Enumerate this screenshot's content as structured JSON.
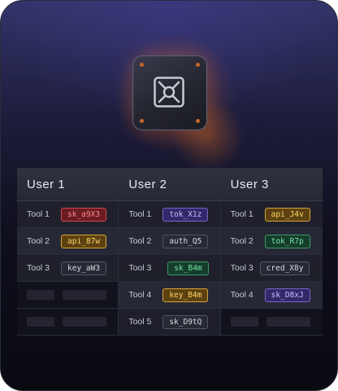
{
  "colors": {
    "red": "#d44a4a",
    "yellow": "#d7a23a",
    "purple": "#7466c9",
    "green": "#3c9868",
    "gray": "#52556a",
    "glow": "#ff8228"
  },
  "vault": {
    "icon": "vault-icon"
  },
  "users": [
    {
      "name": "User 1",
      "rows": [
        {
          "tool": "Tool 1",
          "key": "sk_a9X3",
          "color": "red"
        },
        {
          "tool": "Tool 2",
          "key": "api_87w",
          "color": "yellow"
        },
        {
          "tool": "Tool 3",
          "key": "key_aW3",
          "color": "gray"
        }
      ]
    },
    {
      "name": "User 2",
      "rows": [
        {
          "tool": "Tool 1",
          "key": "tok_X1z",
          "color": "purple"
        },
        {
          "tool": "Tool 2",
          "key": "auth_Q5",
          "color": "gray"
        },
        {
          "tool": "Tool 3",
          "key": "sk_B4m",
          "color": "green"
        },
        {
          "tool": "Tool 4",
          "key": "key_B4m",
          "color": "yellow"
        },
        {
          "tool": "Tool 5",
          "key": "sk_D9tQ",
          "color": "gray"
        }
      ]
    },
    {
      "name": "User 3",
      "rows": [
        {
          "tool": "Tool 1",
          "key": "api_J4v",
          "color": "yellow"
        },
        {
          "tool": "Tool 2",
          "key": "tok_R7p",
          "color": "green"
        },
        {
          "tool": "Tool 3",
          "key": "cred_X8y",
          "color": "gray"
        },
        {
          "tool": "Tool 4",
          "key": "sk_D8xJ",
          "color": "purple"
        }
      ]
    }
  ]
}
